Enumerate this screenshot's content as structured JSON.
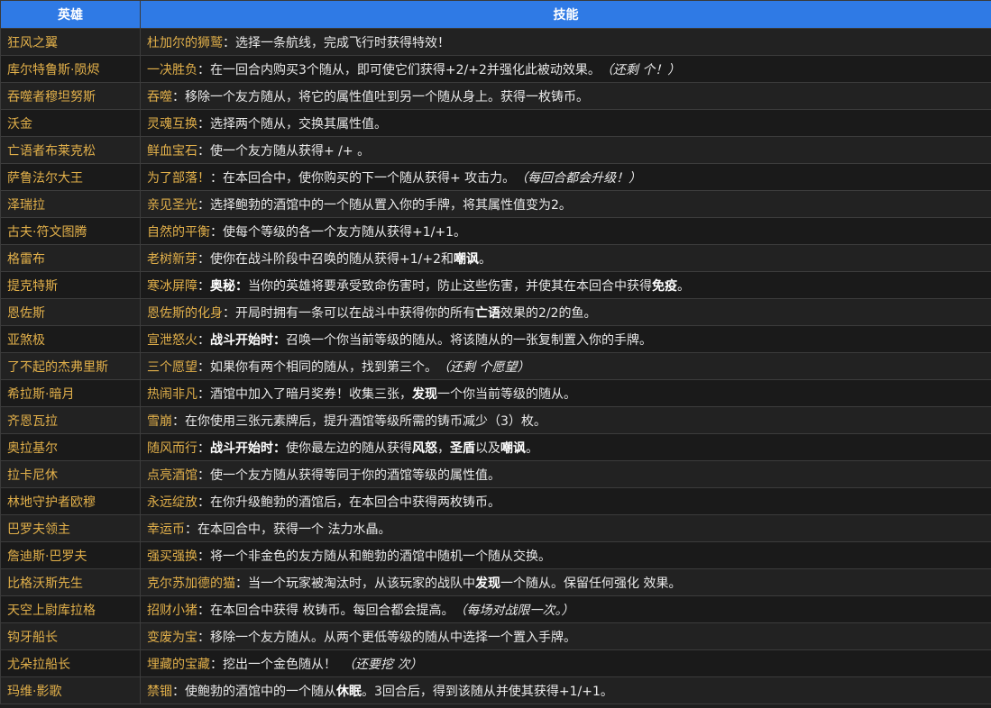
{
  "header": {
    "hero": "英雄",
    "skill": "技能"
  },
  "rows": [
    {
      "hero": "狂风之翼",
      "skill": "杜加尔的狮鹫",
      "desc": "选择一条航线，完成飞行时获得特效！",
      "note": ""
    },
    {
      "hero": "库尔特鲁斯·陨烬",
      "skill": "一决胜负",
      "desc": "在一回合内购买3个随从，即可使它们获得+2/+2并强化此被动效果。",
      "note": "（还剩 个！）"
    },
    {
      "hero": "吞噬者穆坦努斯",
      "skill": "吞噬",
      "desc": "移除一个友方随从，将它的属性值吐到另一个随从身上。获得一枚铸币。",
      "note": ""
    },
    {
      "hero": "沃金",
      "skill": "灵魂互换",
      "desc": "选择两个随从，交换其属性值。",
      "note": ""
    },
    {
      "hero": "亡语者布莱克松",
      "skill": "鲜血宝石",
      "desc": "使一个友方随从获得+ /+ 。",
      "note": ""
    },
    {
      "hero": "萨鲁法尔大王",
      "skill": "为了部落！",
      "desc": "在本回合中，使你购买的下一个随从获得+ 攻击力。",
      "note": "（每回合都会升级！）"
    },
    {
      "hero": "泽瑞拉",
      "skill": "亲见圣光",
      "desc": "选择鲍勃的酒馆中的一个随从置入你的手牌，将其属性值变为2。",
      "note": ""
    },
    {
      "hero": "古夫·符文图腾",
      "skill": "自然的平衡",
      "desc": "使每个等级的各一个友方随从获得+1/+1。",
      "note": ""
    },
    {
      "hero": "格雷布",
      "skill": "老树新芽",
      "desc": "使你在战斗阶段中召唤的随从获得+1/+2和<b>嘲讽</b>。",
      "note": ""
    },
    {
      "hero": "提克特斯",
      "skill": "寒冰屏障",
      "desc": "<b>奥秘：</b>当你的英雄将要承受致命伤害时，防止这些伤害，并使其在本回合中获得<b>免疫</b>。",
      "note": ""
    },
    {
      "hero": "恩佐斯",
      "skill": "恩佐斯的化身",
      "desc": "开局时拥有一条可以在战斗中获得你的所有<b>亡语</b>效果的2/2的鱼。",
      "note": ""
    },
    {
      "hero": "亚煞极",
      "skill": "宣泄怒火",
      "desc": "<b>战斗开始时：</b>召唤一个你当前等级的随从。将该随从的一张复制置入你的手牌。",
      "note": ""
    },
    {
      "hero": "了不起的杰弗里斯",
      "skill": "三个愿望",
      "desc": "如果你有两个相同的随从，找到第三个。",
      "note": "（还剩 个愿望）"
    },
    {
      "hero": "希拉斯·暗月",
      "skill": "热闹非凡",
      "desc": "酒馆中加入了暗月奖券！收集三张，<b>发现</b>一个你当前等级的随从。",
      "note": ""
    },
    {
      "hero": "齐恩瓦拉",
      "skill": "雪崩",
      "desc": "在你使用三张元素牌后，提升酒馆等级所需的铸币减少（3）枚。",
      "note": ""
    },
    {
      "hero": "奥拉基尔",
      "skill": "随风而行",
      "desc": "<b>战斗开始时：</b>使你最左边的随从获得<b>风怒</b>，<b>圣盾</b>以及<b>嘲讽</b>。",
      "note": ""
    },
    {
      "hero": "拉卡尼休",
      "skill": "点亮酒馆",
      "desc": "使一个友方随从获得等同于你的酒馆等级的属性值。",
      "note": ""
    },
    {
      "hero": "林地守护者欧穆",
      "skill": "永远绽放",
      "desc": "在你升级鲍勃的酒馆后，在本回合中获得两枚铸币。",
      "note": ""
    },
    {
      "hero": "巴罗夫领主",
      "skill": "幸运币",
      "desc": "在本回合中，获得一个 法力水晶。",
      "note": ""
    },
    {
      "hero": "詹迪斯·巴罗夫",
      "skill": "强买强换",
      "desc": "将一个非金色的友方随从和鲍勃的酒馆中随机一个随从交换。",
      "note": ""
    },
    {
      "hero": "比格沃斯先生",
      "skill": "克尔苏加德的猫",
      "desc": "当一个玩家被淘汰时，从该玩家的战队中<b>发现</b>一个随从。保留任何强化 效果。",
      "note": ""
    },
    {
      "hero": "天空上尉库拉格",
      "skill": "招财小猪",
      "desc": "在本回合中获得 枚铸币。每回合都会提高。",
      "note": "（每场对战限一次。）"
    },
    {
      "hero": "钩牙船长",
      "skill": "变废为宝",
      "desc": "移除一个友方随从。从两个更低等级的随从中选择一个置入手牌。",
      "note": ""
    },
    {
      "hero": "尤朵拉船长",
      "skill": "埋藏的宝藏",
      "desc": "挖出一个金色随从！",
      "note": "（还要挖 次）"
    },
    {
      "hero": "玛维·影歌",
      "skill": "禁锢",
      "desc": "使鲍勃的酒馆中的一个随从<b>休眠</b>。3回合后，得到该随从并使其获得+1/+1。",
      "note": ""
    }
  ]
}
